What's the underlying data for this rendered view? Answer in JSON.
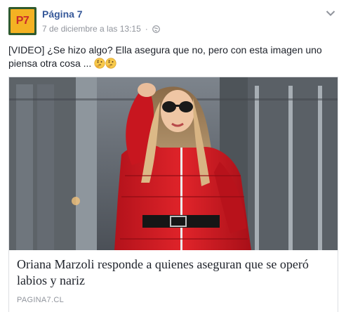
{
  "post": {
    "page_name": "Página 7",
    "avatar_text": "P7",
    "timestamp": "7 de diciembre a las 13:15",
    "separator": "·",
    "privacy_icon": "globe-icon",
    "options_icon": "chevron-down-icon",
    "text": "[VIDEO] ¿Se hizo algo? Ella asegura que no, pero con esta imagen uno piensa otra cosa ...",
    "emojis": [
      "thinking-face-icon",
      "thinking-face-icon"
    ]
  },
  "link_card": {
    "image": "photo-woman-red-jacket",
    "title": "Oriana Marzoli responde a quienes aseguran que se operó labios y nariz",
    "domain": "PAGINA7.CL"
  },
  "colors": {
    "page_name": "#365899",
    "meta": "#90949c",
    "text": "#1d2129",
    "border": "#dddfe2",
    "avatar_bg": "#f4b223",
    "avatar_text": "#c92a2a"
  }
}
